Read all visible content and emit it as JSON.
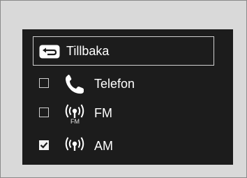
{
  "menu": {
    "back": {
      "label": "Tillbaka",
      "icon": "return-arrow-icon"
    },
    "items": [
      {
        "label": "Telefon",
        "icon": "phone-icon",
        "checked": false
      },
      {
        "label": "FM",
        "icon": "radio-antenna-icon",
        "sublabel": "FM",
        "checked": false
      },
      {
        "label": "AM",
        "icon": "radio-antenna-icon",
        "checked": true
      }
    ]
  },
  "colors": {
    "screen_bg": "#1c1c1c",
    "frame_bg": "#d9d9d9",
    "text": "#ffffff"
  }
}
